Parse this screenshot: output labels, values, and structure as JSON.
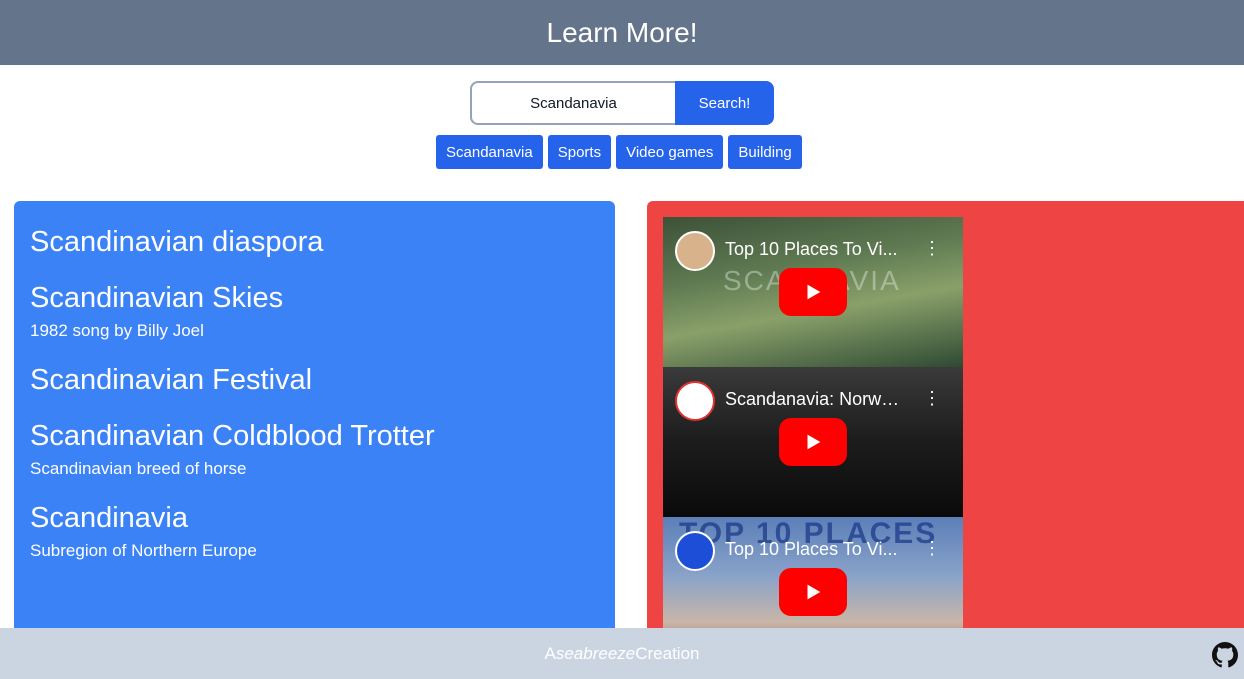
{
  "header": {
    "title": "Learn More!"
  },
  "search": {
    "value": "Scandanavia",
    "button_label": "Search!"
  },
  "chips": [
    "Scandanavia",
    "Sports",
    "Video games",
    "Building"
  ],
  "wiki_results": [
    {
      "title": "Scandinavian diaspora",
      "description": ""
    },
    {
      "title": "Scandinavian Skies",
      "description": "1982 song by Billy Joel"
    },
    {
      "title": "Scandinavian Festival",
      "description": ""
    },
    {
      "title": "Scandinavian Coldblood Trotter",
      "description": "Scandinavian breed of horse"
    },
    {
      "title": "Scandinavia",
      "description": "Subregion of Northern Europe"
    }
  ],
  "videos": [
    {
      "title": "Top 10 Places To Vi...",
      "thumb_text": "SCANDAVIA"
    },
    {
      "title": "Scandanavia: Norwa...",
      "thumb_text": ""
    },
    {
      "title": "Top 10 Places To Vi...",
      "thumb_text": "TOP 10 PLACES"
    }
  ],
  "footer": {
    "prefix": "A ",
    "brand": "seabreeze",
    "suffix": " Creation"
  },
  "colors": {
    "header_bg": "#64748b",
    "accent": "#2563eb",
    "wiki_panel": "#3b82f6",
    "video_panel": "#ef4444",
    "footer_bg": "#cbd5e1"
  }
}
